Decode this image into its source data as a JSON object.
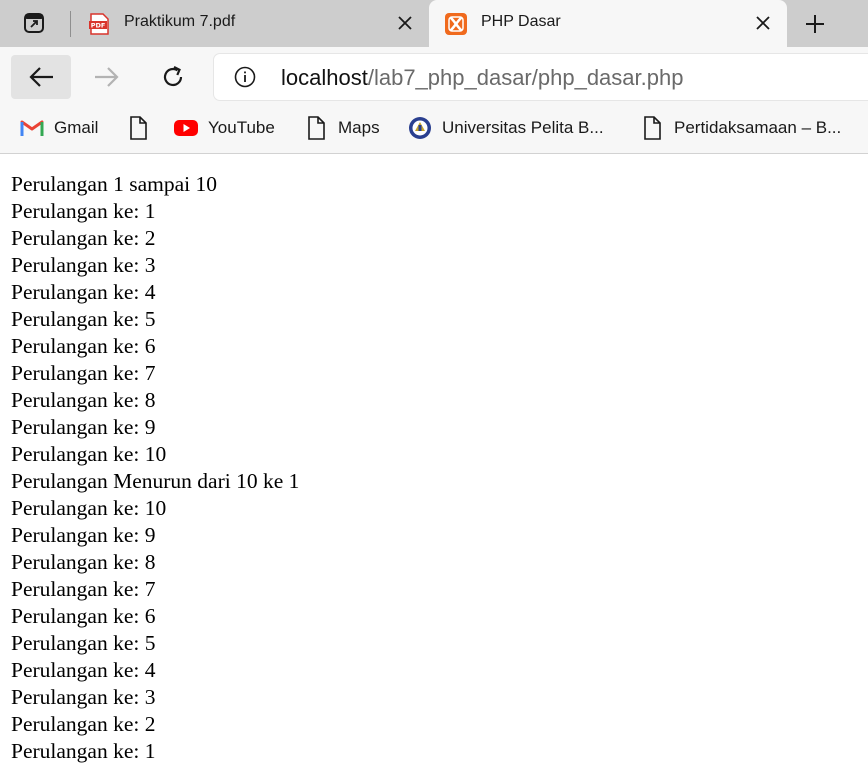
{
  "tabs": [
    {
      "title": "Praktikum 7.pdf",
      "icon": "pdf-icon",
      "active": false
    },
    {
      "title": "PHP Dasar",
      "icon": "xampp-icon",
      "active": true
    }
  ],
  "toolbar": {
    "url_host": "localhost",
    "url_path": "/lab7_php_dasar/php_dasar.php"
  },
  "bookmarks": [
    {
      "label": "Gmail",
      "icon": "gmail-icon"
    },
    {
      "label": "",
      "icon": "document-icon"
    },
    {
      "label": "YouTube",
      "icon": "youtube-icon"
    },
    {
      "label": "Maps",
      "icon": "document-icon"
    },
    {
      "label": "Universitas Pelita B...",
      "icon": "university-logo-icon"
    },
    {
      "label": "Pertidaksamaan – B...",
      "icon": "document-icon"
    }
  ],
  "content": {
    "lines": [
      "Perulangan 1 sampai 10",
      "Perulangan ke: 1",
      "Perulangan ke: 2",
      "Perulangan ke: 3",
      "Perulangan ke: 4",
      "Perulangan ke: 5",
      "Perulangan ke: 6",
      "Perulangan ke: 7",
      "Perulangan ke: 8",
      "Perulangan ke: 9",
      "Perulangan ke: 10",
      "Perulangan Menurun dari 10 ke 1",
      "Perulangan ke: 10",
      "Perulangan ke: 9",
      "Perulangan ke: 8",
      "Perulangan ke: 7",
      "Perulangan ke: 6",
      "Perulangan ke: 5",
      "Perulangan ke: 4",
      "Perulangan ke: 3",
      "Perulangan ke: 2",
      "Perulangan ke: 1"
    ]
  },
  "colors": {
    "pdf": "#d9352c",
    "xampp": "#f06a1d",
    "youtube": "#ff0000",
    "gmail_red": "#ea4335"
  }
}
